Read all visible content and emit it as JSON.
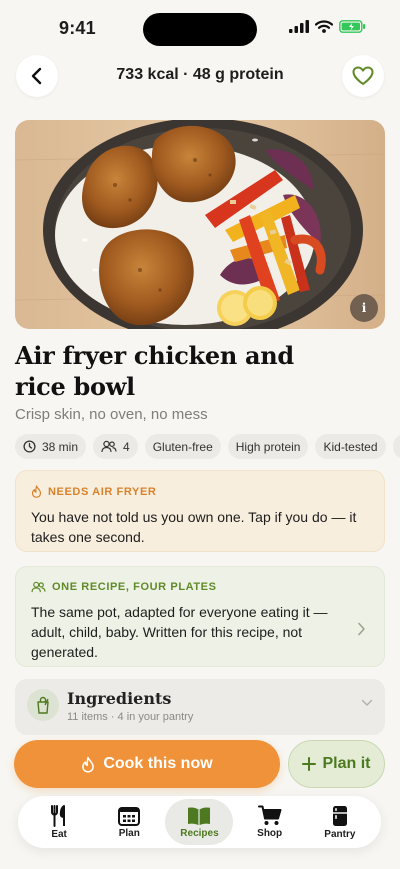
{
  "status": {
    "time": "9:41"
  },
  "header": {
    "title": "733 kcal · 48 g protein"
  },
  "hero": {
    "info_glyph": "i"
  },
  "recipe": {
    "title": "Air fryer chicken and rice bowl",
    "subtitle": "Crisp skin, no oven, no mess"
  },
  "chips": {
    "time": "38 min",
    "servings": "4",
    "tags": [
      "Gluten-free",
      "High protein",
      "Kid-tested",
      "B"
    ]
  },
  "air_fryer_card": {
    "label": "NEEDS AIR FRYER",
    "body": "You have not told us you own one. Tap if you do — it takes one second."
  },
  "plates_card": {
    "label": "ONE RECIPE, FOUR PLATES",
    "body": "The same pot, adapted for everyone eating it — adult, child, baby. Written for this recipe, not generated."
  },
  "ingredients": {
    "title": "Ingredients",
    "subtitle": "11 items · 4 in your pantry"
  },
  "actions": {
    "cook_label": "Cook this now",
    "plan_label": "Plan it"
  },
  "tabs": [
    {
      "label": "Eat",
      "icon": "fork-knife-icon"
    },
    {
      "label": "Plan",
      "icon": "calendar-icon"
    },
    {
      "label": "Recipes",
      "icon": "book-icon"
    },
    {
      "label": "Shop",
      "icon": "cart-icon"
    },
    {
      "label": "Pantry",
      "icon": "fridge-icon"
    }
  ],
  "colors": {
    "accent_orange": "#f0923a",
    "accent_green": "#4d7a20",
    "background": "#f7f6f2"
  }
}
